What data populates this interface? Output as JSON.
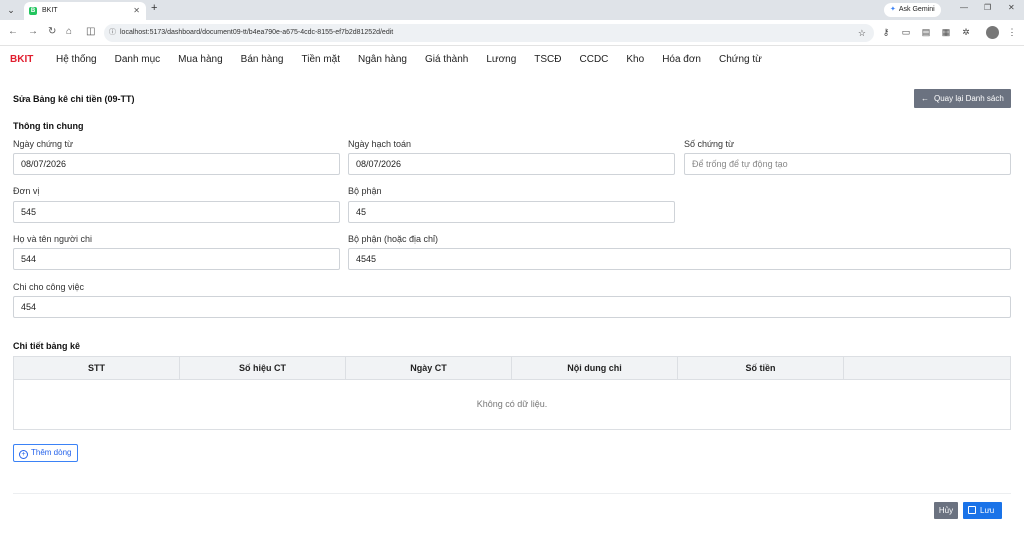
{
  "browser": {
    "tab_title": "BKIT",
    "favicon_letter": "B",
    "url": "localhost:5173/dashboard/document09-tt/b4ea790e-a675-4cdc-8155-ef7b2d81252d/edit",
    "ask_gemini": "Ask Gemini"
  },
  "app": {
    "brand": "BKIT",
    "menu": [
      "Hệ thống",
      "Danh mục",
      "Mua hàng",
      "Bán hàng",
      "Tiền mặt",
      "Ngân hàng",
      "Giá thành",
      "Lương",
      "TSCĐ",
      "CCDC",
      "Kho",
      "Hóa đơn",
      "Chứng từ"
    ]
  },
  "page": {
    "title": "Sửa Bảng kê chi tiền (09-TT)",
    "back_label": "Quay lại Danh sách"
  },
  "general": {
    "section_title": "Thông tin chung",
    "doc_date_label": "Ngày chứng từ",
    "doc_date_value": "08/07/2026",
    "posting_date_label": "Ngày hạch toán",
    "posting_date_value": "08/07/2026",
    "doc_number_label": "Số chứng từ",
    "doc_number_placeholder": "Để trống để tự động tạo",
    "unit_label": "Đơn vị",
    "unit_value": "545",
    "department_label": "Bộ phận",
    "department_value": "45",
    "payer_name_label": "Họ và tên người chi",
    "payer_name_value": "544",
    "payer_department_label": "Bộ phận (hoặc địa chỉ)",
    "payer_department_value": "4545",
    "purpose_label": "Chi cho công việc",
    "purpose_value": "454"
  },
  "details": {
    "section_title": "Chi tiết bảng kê",
    "columns": [
      "STT",
      "Số hiệu CT",
      "Ngày CT",
      "Nội dung chi",
      "Số tiền",
      ""
    ],
    "empty_text": "Không có dữ liệu.",
    "add_row_label": "Thêm dòng"
  },
  "footer": {
    "cancel_label": "Hủy",
    "save_label": "Lưu"
  }
}
